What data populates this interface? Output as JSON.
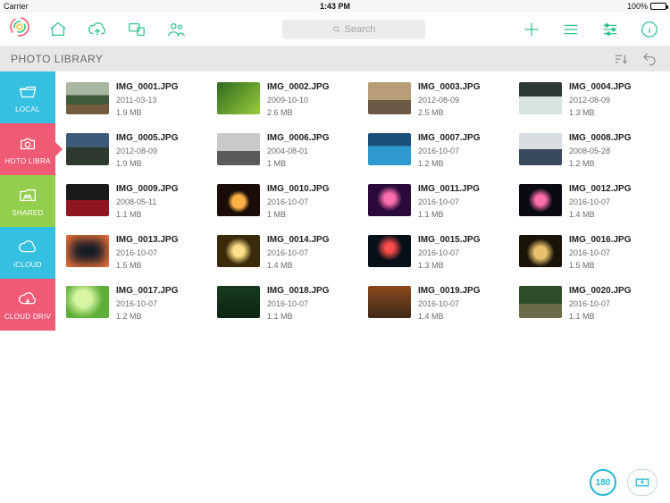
{
  "status": {
    "carrier": "Carrier",
    "wifi": "▴",
    "time": "1:43 PM",
    "battery_pct": "100%"
  },
  "search": {
    "placeholder": "Search"
  },
  "header": {
    "title": "PHOTO LIBRARY"
  },
  "sidebar": {
    "items": [
      {
        "key": "local",
        "label": "LOCAL"
      },
      {
        "key": "photo",
        "label": "HOTO LIBRA"
      },
      {
        "key": "shared",
        "label": "SHARED"
      },
      {
        "key": "icloud",
        "label": "iCLOUD"
      },
      {
        "key": "cdrive",
        "label": "CLOUD DRIV"
      }
    ],
    "active": "photo"
  },
  "files": [
    {
      "name": "IMG_0001.JPG",
      "date": "2011-03-13",
      "size": "1.9 MB",
      "thumb": "t-mtn"
    },
    {
      "name": "IMG_0002.JPG",
      "date": "2009-10-10",
      "size": "2.6 MB",
      "thumb": "t-leaf"
    },
    {
      "name": "IMG_0003.JPG",
      "date": "2012-08-09",
      "size": "2.5 MB",
      "thumb": "t-canyon"
    },
    {
      "name": "IMG_0004.JPG",
      "date": "2012-08-09",
      "size": "1.3 MB",
      "thumb": "t-water"
    },
    {
      "name": "IMG_0005.JPG",
      "date": "2012-08-09",
      "size": "1.9 MB",
      "thumb": "t-rainbw"
    },
    {
      "name": "IMG_0006.JPG",
      "date": "2004-08-01",
      "size": "1 MB",
      "thumb": "t-car1"
    },
    {
      "name": "IMG_0007.JPG",
      "date": "2016-10-07",
      "size": "1.2 MB",
      "thumb": "t-sea"
    },
    {
      "name": "IMG_0008.JPG",
      "date": "2008-05-28",
      "size": "1.2 MB",
      "thumb": "t-car2"
    },
    {
      "name": "IMG_0009.JPG",
      "date": "2008-05-11",
      "size": "1.1 MB",
      "thumb": "t-car3"
    },
    {
      "name": "IMG_0010.JPG",
      "date": "2016-10-07",
      "size": "1 MB",
      "thumb": "t-fw1"
    },
    {
      "name": "IMG_0011.JPG",
      "date": "2016-10-07",
      "size": "1.1 MB",
      "thumb": "t-fw2"
    },
    {
      "name": "IMG_0012.JPG",
      "date": "2016-10-07",
      "size": "1.4 MB",
      "thumb": "t-fw3"
    },
    {
      "name": "IMG_0013.JPG",
      "date": "2016-10-07",
      "size": "1.5 MB",
      "thumb": "t-fw4"
    },
    {
      "name": "IMG_0014.JPG",
      "date": "2016-10-07",
      "size": "1.4 MB",
      "thumb": "t-fw5"
    },
    {
      "name": "IMG_0015.JPG",
      "date": "2016-10-07",
      "size": "1.3 MB",
      "thumb": "t-fw6"
    },
    {
      "name": "IMG_0016.JPG",
      "date": "2016-10-07",
      "size": "1.5 MB",
      "thumb": "t-fw7"
    },
    {
      "name": "IMG_0017.JPG",
      "date": "2016-10-07",
      "size": "1.2 MB",
      "thumb": "t-gleaf"
    },
    {
      "name": "IMG_0018.JPG",
      "date": "2016-10-07",
      "size": "1.1 MB",
      "thumb": "t-forest"
    },
    {
      "name": "IMG_0019.JPG",
      "date": "2016-10-07",
      "size": "1.4 MB",
      "thumb": "t-fall"
    },
    {
      "name": "IMG_0020.JPG",
      "date": "2016-10-07",
      "size": "1.1 MB",
      "thumb": "t-path"
    }
  ],
  "footer": {
    "count": "180"
  }
}
